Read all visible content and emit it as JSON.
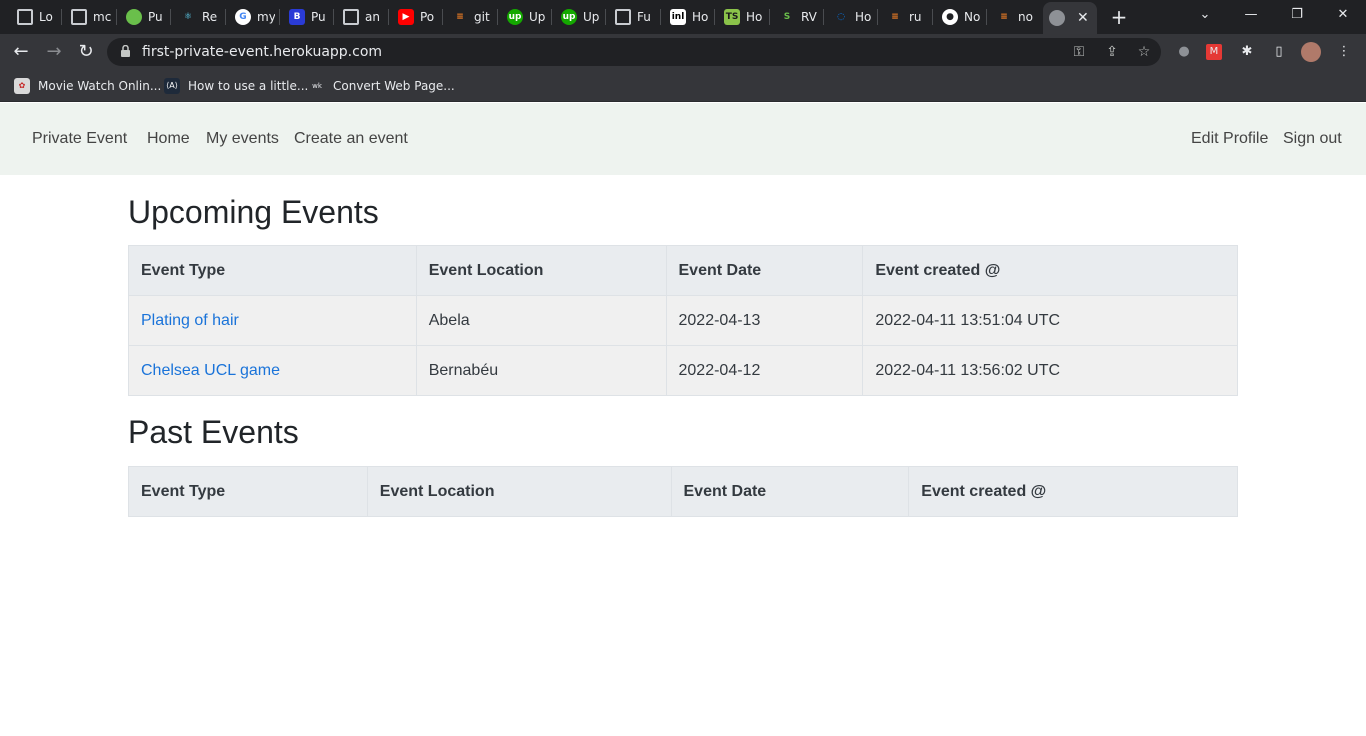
{
  "browser": {
    "tabs": [
      {
        "title": "Lo",
        "icon": "generic-page-icon"
      },
      {
        "title": "mc",
        "icon": "generic-page-icon"
      },
      {
        "title": "Pu",
        "icon": "leaf-icon"
      },
      {
        "title": "Re",
        "icon": "react-icon"
      },
      {
        "title": "my",
        "icon": "google-icon"
      },
      {
        "title": "Pu",
        "icon": "bootstrap-icon"
      },
      {
        "title": "an",
        "icon": "generic-page-icon"
      },
      {
        "title": "Po",
        "icon": "youtube-icon"
      },
      {
        "title": "git",
        "icon": "stackoverflow-icon"
      },
      {
        "title": "Up",
        "icon": "upwork-icon"
      },
      {
        "title": "Up",
        "icon": "upwork-icon"
      },
      {
        "title": "Fu",
        "icon": "generic-page-icon"
      },
      {
        "title": "Ho",
        "icon": "inl-icon"
      },
      {
        "title": "Ho",
        "icon": "typescript-icon"
      },
      {
        "title": "RV",
        "icon": "stripe-s-icon"
      },
      {
        "title": "Ho",
        "icon": "digitalocean-icon"
      },
      {
        "title": "ru",
        "icon": "stackoverflow-icon"
      },
      {
        "title": "No",
        "icon": "github-icon"
      },
      {
        "title": "no",
        "icon": "stackoverflow-icon"
      }
    ],
    "active_tab_icon": "globe-icon",
    "url": "first-private-event.herokuapp.com",
    "bookmarks": [
      {
        "label": "Movie Watch Onlin...",
        "icon": "film-icon"
      },
      {
        "label": "How to use a little...",
        "icon": "code-icon"
      },
      {
        "label": "Convert Web Page...",
        "icon": "wkhtml-icon"
      }
    ]
  },
  "navbar": {
    "brand": "Private Event",
    "links": [
      "Home",
      "My events",
      "Create an event"
    ],
    "right_links": [
      "Edit Profile",
      "Sign out"
    ]
  },
  "upcoming": {
    "title": "Upcoming Events",
    "headers": [
      "Event Type",
      "Event Location",
      "Event Date",
      "Event created @"
    ],
    "rows": [
      [
        "Plating of hair",
        "Abela",
        "2022-04-13",
        "2022-04-11 13:51:04 UTC"
      ],
      [
        "Chelsea UCL game",
        "Bernabéu",
        "2022-04-12",
        "2022-04-11 13:56:02 UTC"
      ]
    ]
  },
  "past": {
    "title": "Past Events",
    "headers": [
      "Event Type",
      "Event Location",
      "Event Date",
      "Event created @"
    ]
  },
  "colors": {
    "navbar_bg": "#eef3ef",
    "link": "#1a73d9",
    "table_header_bg": "#e9ecef",
    "table_row_bg": "#f0f0f0"
  }
}
